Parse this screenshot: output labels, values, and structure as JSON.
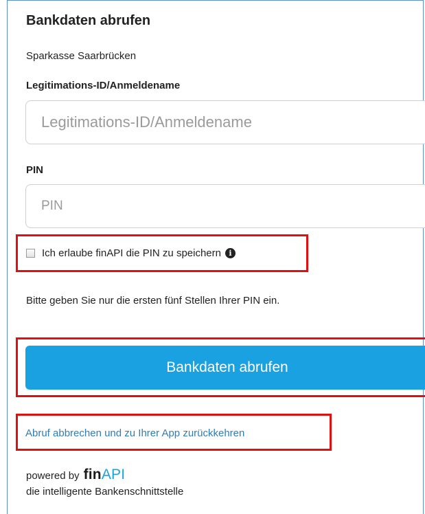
{
  "form": {
    "title": "Bankdaten abrufen",
    "bank_name": "Sparkasse Saarbrücken",
    "login_label": "Legitimations-ID/Anmeldename",
    "login_placeholder": "Legitimations-ID/Anmeldename",
    "login_value": "",
    "pin_label": "PIN",
    "pin_placeholder": "PIN",
    "pin_value": "",
    "consent_text": "Ich erlaube finAPI die PIN zu speichern",
    "consent_checked": false,
    "info_icon": "info-circle-icon",
    "hint": "Bitte geben Sie nur die ersten fünf Stellen Ihrer PIN ein.",
    "submit_label": "Bankdaten abrufen",
    "cancel_link": "Abruf abbrechen und zu Ihrer App zurückkehren"
  },
  "footer": {
    "powered_by": "powered by",
    "brand_fin": "fin",
    "brand_api": "API",
    "tagline": "die intelligente Bankenschnittstelle"
  },
  "colors": {
    "accent": "#1aa1e1",
    "link": "#2f7cb5",
    "highlight": "#e01010"
  }
}
